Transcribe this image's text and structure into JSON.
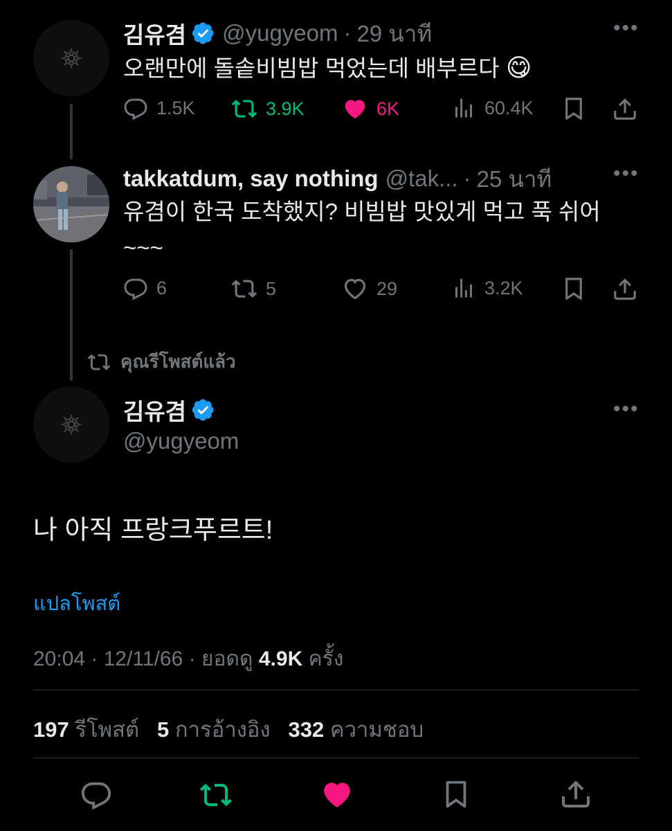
{
  "tweet1": {
    "name": "김유겸",
    "handle": "@yugyeom",
    "separator": "·",
    "time": "29 นาที",
    "text": "오랜만에 돌솥비빔밥 먹었는데 배부르다",
    "emoji": "😋",
    "replies": "1.5K",
    "retweets": "3.9K",
    "likes": "6K",
    "views": "60.4K"
  },
  "tweet2": {
    "name": "takkatdum, say nothing",
    "handle": "@tak...",
    "separator": "·",
    "time": "25 นาที",
    "text_line1": "유겸이 한국 도착했지? 비빔밥 맛있게 먹고 푹 쉬어",
    "text_line2": "~~~",
    "replies": "6",
    "retweets": "5",
    "likes": "29",
    "views": "3.2K"
  },
  "repost_notice": "คุณรีโพสต์แล้ว",
  "main_tweet": {
    "name": "김유겸",
    "handle": "@yugyeom",
    "text": "나 아직 프랑크푸르트!",
    "translate_link": "แปลโพสต์",
    "timestamp": "20:04 · 12/11/66 · ยอดดู",
    "views_count": "4.9K",
    "views_suffix": "ครั้ง",
    "reposts_count": "197",
    "reposts_label": "รีโพสต์",
    "quotes_count": "5",
    "quotes_label": "การอ้างอิง",
    "likes_count": "332",
    "likes_label": "ความชอบ"
  },
  "colors": {
    "background": "#000000",
    "text": "#e7e9ea",
    "muted": "#71767b",
    "repost_green": "#00ba7c",
    "like_pink": "#f91880",
    "link_blue": "#1d9bf0",
    "verified_blue": "#1d9bf0"
  },
  "icons": [
    "reply-icon",
    "retweet-icon",
    "like-icon",
    "views-icon",
    "bookmark-icon",
    "share-icon",
    "more-icon",
    "verified-icon"
  ]
}
